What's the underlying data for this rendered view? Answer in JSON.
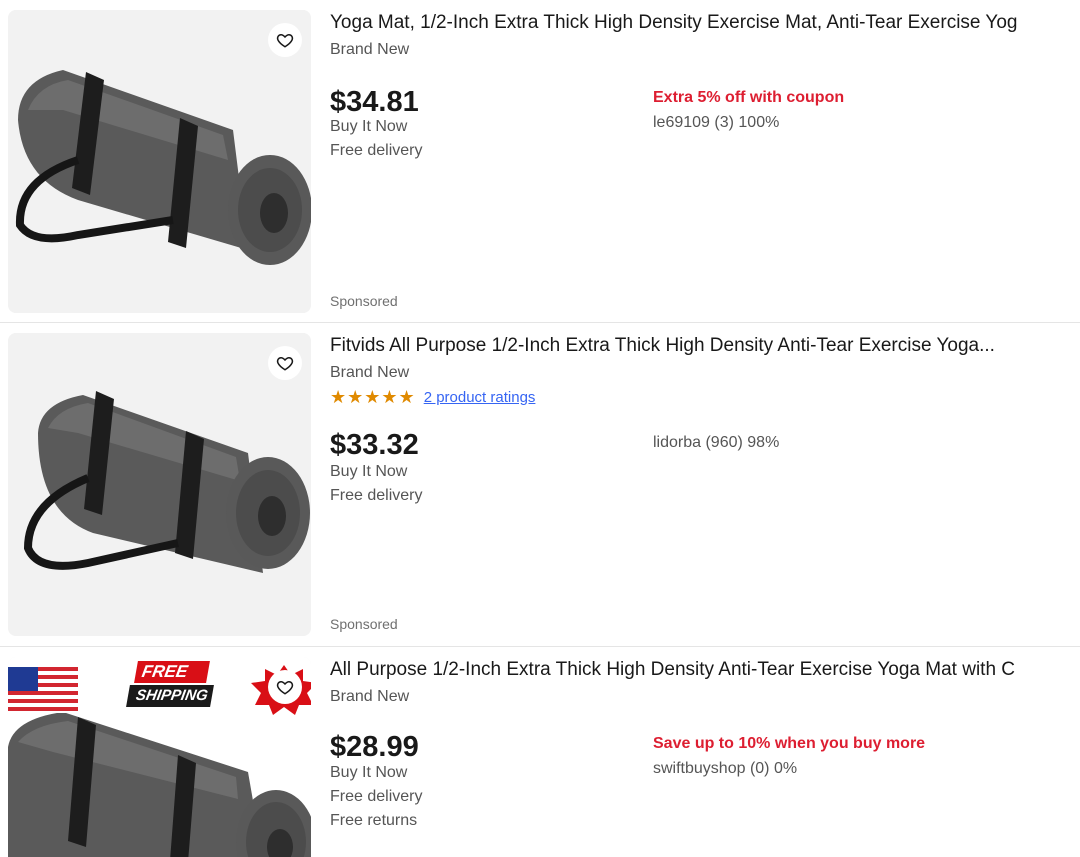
{
  "listings": [
    {
      "title": "Yoga Mat, 1/2-Inch Extra Thick High Density Exercise Mat, Anti-Tear Exercise Yog",
      "condition": "Brand New",
      "price": "$34.81",
      "format": "Buy It Now",
      "delivery": "Free delivery",
      "promo": "Extra 5% off with coupon",
      "seller": "le69109 (3) 100%",
      "sponsored": "Sponsored",
      "icon": "heart-icon"
    },
    {
      "title": "Fitvids All Purpose 1/2-Inch Extra Thick High Density Anti-Tear Exercise Yoga...",
      "condition": "Brand New",
      "stars": "★★★★★",
      "rating_value": 5,
      "ratings_link": "2 product ratings",
      "price": "$33.32",
      "format": "Buy It Now",
      "delivery": "Free delivery",
      "seller": "lidorba (960) 98%",
      "sponsored": "Sponsored",
      "icon": "heart-icon"
    },
    {
      "title": "All Purpose 1/2-Inch Extra Thick High Density Anti-Tear Exercise Yoga Mat with C",
      "condition": "Brand New",
      "price": "$28.99",
      "format": "Buy It Now",
      "delivery": "Free delivery",
      "returns": "Free returns",
      "promo": "Save up to 10% when you buy more",
      "seller": "swiftbuyshop (0) 0%",
      "badge_free_line1": "FREE",
      "badge_free_line2": "SHIPPING",
      "icon": "heart-icon"
    }
  ],
  "colors": {
    "promo": "#dd1e31",
    "link": "#3665f3",
    "star": "#e08a00",
    "text": "#191919",
    "muted": "#555555"
  }
}
